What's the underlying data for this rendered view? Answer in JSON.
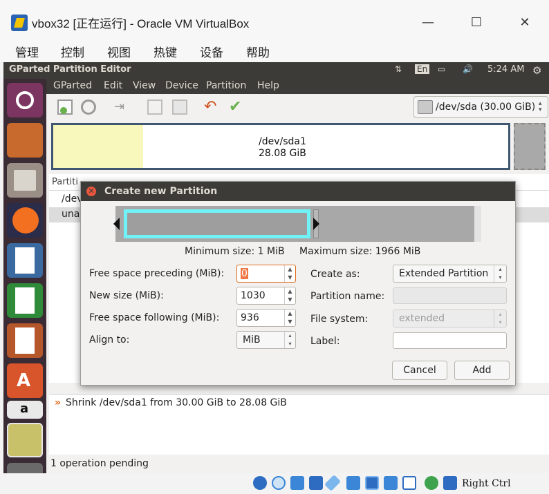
{
  "window": {
    "title": "vbox32 [正在运行] - Oracle VM VirtualBox",
    "minimize": "—",
    "maximize": "☐",
    "close": "✕",
    "menu": [
      "管理",
      "控制",
      "视图",
      "热键",
      "设备",
      "帮助"
    ]
  },
  "guest_topbar": {
    "title": "GParted Partition Editor",
    "keyboard": "En",
    "time": "5:24 AM"
  },
  "gparted": {
    "menu": [
      "GParted",
      "Edit",
      "View",
      "Device",
      "Partition",
      "Help"
    ],
    "device": "/dev/sda  (30.00 GiB)",
    "diskmap_label": "/dev/sda1",
    "diskmap_size": "28.08 GiB",
    "list_header": "Partiti",
    "rows": [
      "/dev",
      "unal"
    ],
    "operation": "Shrink /dev/sda1 from 30.00 GiB to 28.08 GiB",
    "status": "1 operation pending"
  },
  "dialog": {
    "title": "Create new Partition",
    "min_size": "Minimum size: 1 MiB",
    "max_size": "Maximum size: 1966 MiB",
    "preceding_label": "Free space preceding (MiB):",
    "preceding_value": "0",
    "newsize_label": "New size (MiB):",
    "newsize_value": "1030",
    "following_label": "Free space following (MiB):",
    "following_value": "936",
    "align_label": "Align to:",
    "align_value": "MiB",
    "createas_label": "Create as:",
    "createas_value": "Extended Partition",
    "partname_label": "Partition name:",
    "filesystem_label": "File system:",
    "filesystem_value": "extended",
    "label_label": "Label:",
    "cancel": "Cancel",
    "add": "Add"
  },
  "vbox_status": {
    "host_key": "Right Ctrl"
  },
  "colors": {
    "accent_selection": "#6ff3f7",
    "used_space": "#f8f8bd",
    "ubuntu_bar": "#3c3b37"
  }
}
